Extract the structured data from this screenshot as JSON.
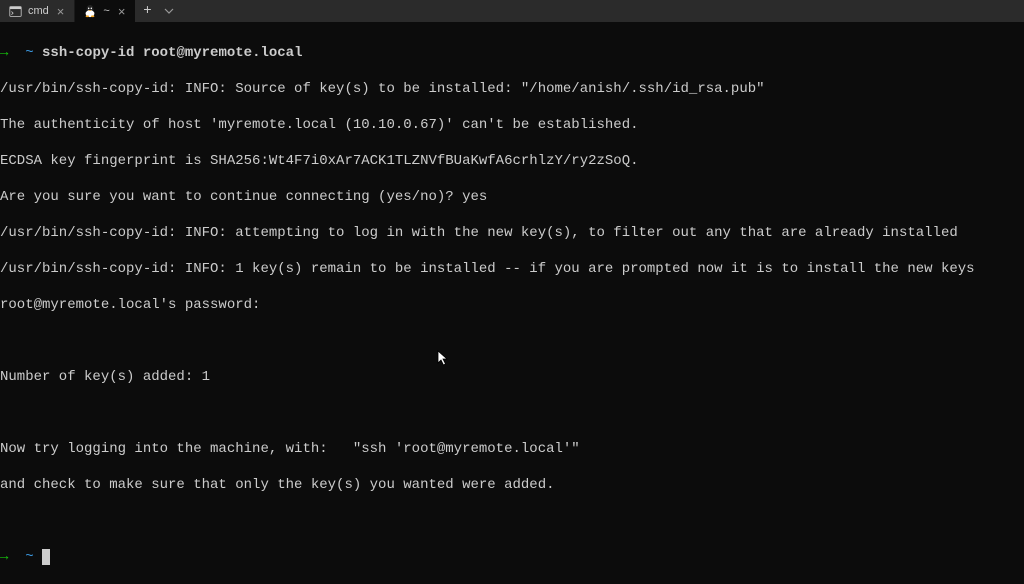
{
  "tabs": {
    "inactive_label": "cmd",
    "active_label": "~"
  },
  "prompt": {
    "arrow": "→",
    "tilde": "~"
  },
  "cmd": "ssh-copy-id root@myremote.local",
  "out": {
    "l1": "/usr/bin/ssh-copy-id: INFO: Source of key(s) to be installed: \"/home/anish/.ssh/id_rsa.pub\"",
    "l2": "The authenticity of host 'myremote.local (10.10.0.67)' can't be established.",
    "l3": "ECDSA key fingerprint is SHA256:Wt4F7i0xAr7ACK1TLZNVfBUaKwfA6crhlzY/ry2zSoQ.",
    "l4": "Are you sure you want to continue connecting (yes/no)? yes",
    "l5": "/usr/bin/ssh-copy-id: INFO: attempting to log in with the new key(s), to filter out any that are already installed",
    "l6": "/usr/bin/ssh-copy-id: INFO: 1 key(s) remain to be installed -- if you are prompted now it is to install the new keys",
    "l7": "root@myremote.local's password:",
    "l8": "Number of key(s) added: 1",
    "l9": "Now try logging into the machine, with:   \"ssh 'root@myremote.local'\"",
    "l10": "and check to make sure that only the key(s) you wanted were added."
  }
}
